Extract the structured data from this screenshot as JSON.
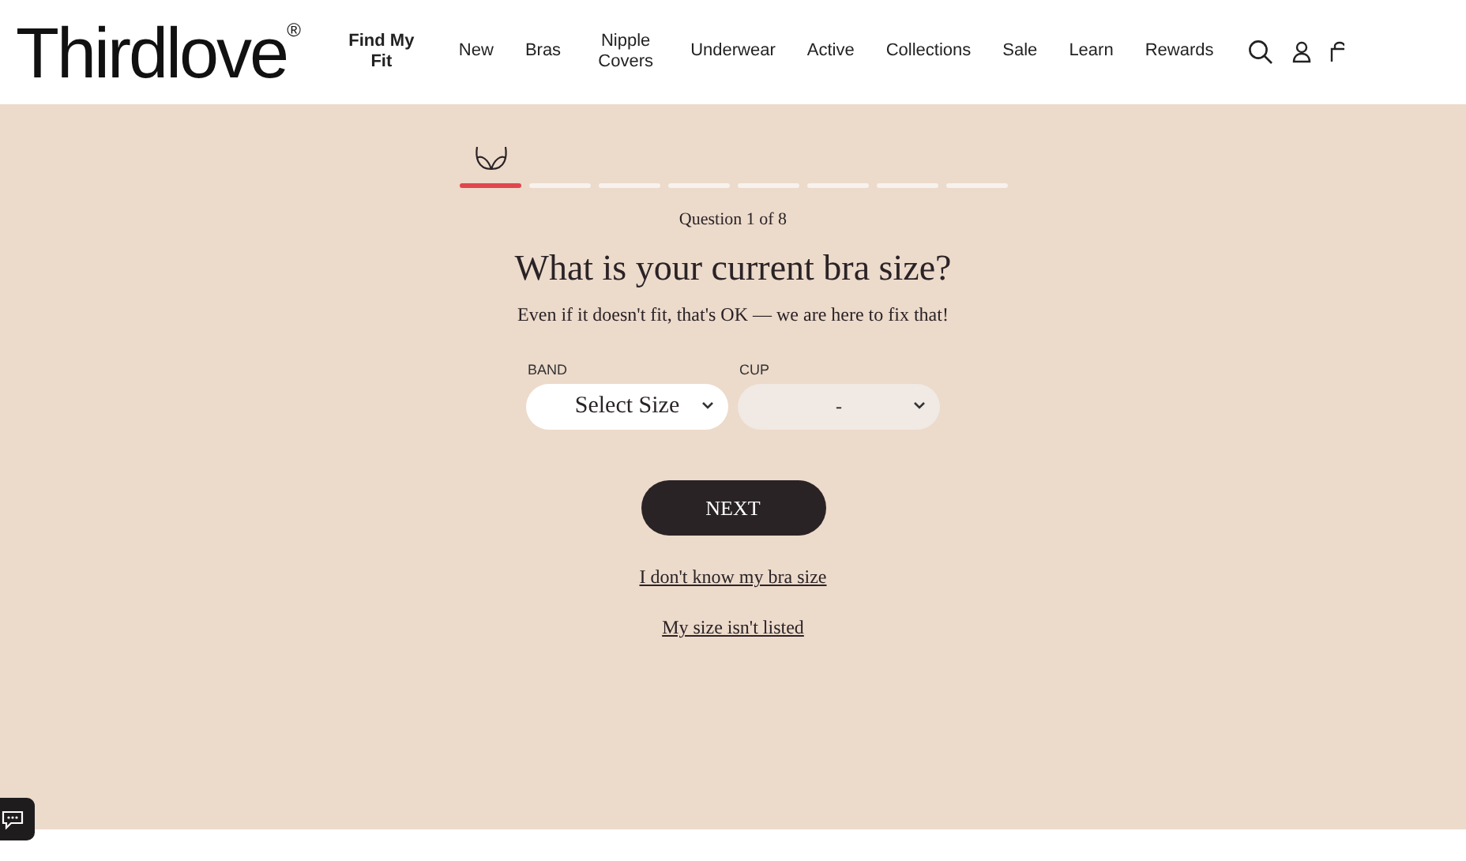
{
  "header": {
    "logo": "Thirdlove$^{®}$",
    "nav": [
      "Find My Fit",
      "New",
      "Bras",
      "Nipple Covers",
      "Underwear",
      "Active",
      "Collections",
      "Sale",
      "Learn",
      "Rewards"
    ]
  },
  "quiz": {
    "steps": [
      {
        "selected": true
      },
      {
        "selected": false
      },
      {
        "selected": false
      },
      {
        "selected": false
      },
      {
        "selected": false
      },
      {
        "selected": false
      },
      {
        "selected": false
      },
      {
        "selected": false
      }
    ],
    "counter": "Question 1 of 8",
    "question": "What is your current bra size?",
    "subtitle": "Even if it doesn't fit, that's OK — we are here to fix that!",
    "selects": [
      {
        "label": "BAND",
        "value": "Select Size",
        "disabled": false
      },
      {
        "label": "CUP",
        "value": "-",
        "disabled": true
      }
    ],
    "next_button": "NEXT",
    "links": [
      "I don't know my bra size",
      "My size isn't listed"
    ]
  }
}
